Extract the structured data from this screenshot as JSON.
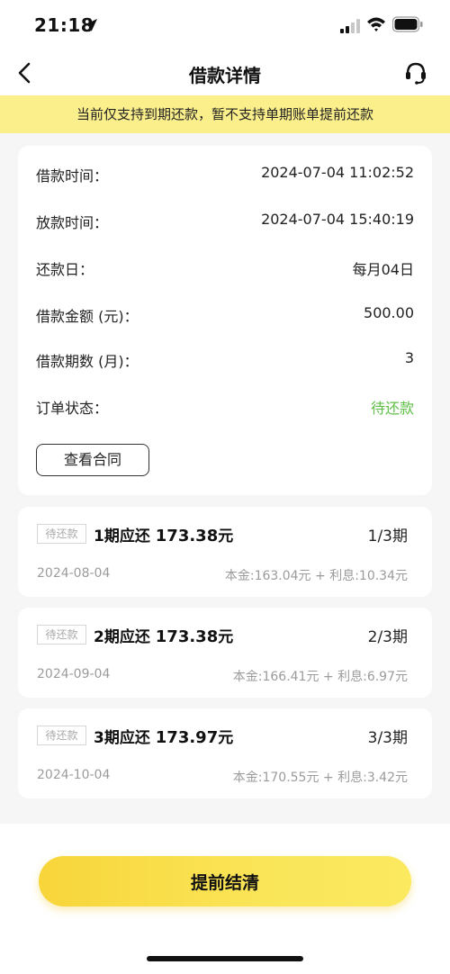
{
  "status_bar": {
    "time": "21:18"
  },
  "nav": {
    "title": "借款详情"
  },
  "notice": {
    "text": "当前仅支持到期还款，暂不支持单期账单提前还款"
  },
  "details": {
    "rows": [
      {
        "label": "借款时间：",
        "value": "2024-07-04 11:02:52"
      },
      {
        "label": "放款时间：",
        "value": "2024-07-04 15:40:19"
      },
      {
        "label": "还款日：",
        "value": "每月04日"
      },
      {
        "label": "借款金额 (元)：",
        "value": "500.00"
      },
      {
        "label": "借款期数 (月)：",
        "value": "3"
      },
      {
        "label": "订单状态：",
        "value": "待还款"
      }
    ],
    "contract_button": "查看合同"
  },
  "installments": [
    {
      "status": "待还款",
      "title_prefix": "1期应还",
      "amount": "173.38",
      "unit": "元",
      "period": "1/3期",
      "date": "2024-08-04",
      "breakdown": "本金:163.04元 + 利息:10.34元"
    },
    {
      "status": "待还款",
      "title_prefix": "2期应还",
      "amount": "173.38",
      "unit": "元",
      "period": "2/3期",
      "date": "2024-09-04",
      "breakdown": "本金:166.41元 + 利息:6.97元"
    },
    {
      "status": "待还款",
      "title_prefix": "3期应还",
      "amount": "173.97",
      "unit": "元",
      "period": "3/3期",
      "date": "2024-10-04",
      "breakdown": "本金:170.55元 + 利息:3.42元"
    }
  ],
  "bottom": {
    "settle_button": "提前结清"
  },
  "colors": {
    "accent_yellow": "#f8d53a",
    "notice_bg": "#fbef8b",
    "status_green": "#5fbf47"
  }
}
